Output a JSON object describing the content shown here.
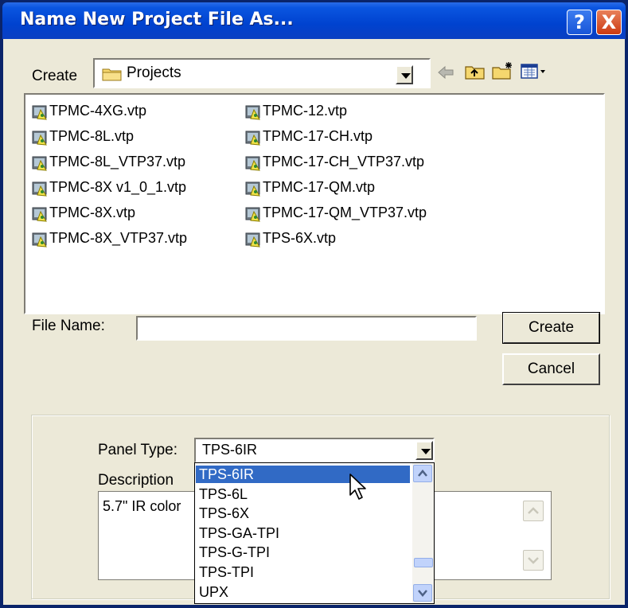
{
  "window": {
    "title": "Name New Project File As...",
    "help_glyph": "?",
    "close_glyph": "X"
  },
  "create_bar": {
    "label": "Create",
    "folder": "Projects",
    "icons": [
      "back-arrow-icon",
      "up-folder-icon",
      "new-folder-icon",
      "view-menu-icon"
    ]
  },
  "files": {
    "column1": [
      "TPMC-4XG.vtp",
      "TPMC-8L.vtp",
      "TPMC-8L_VTP37.vtp",
      "TPMC-8X v1_0_1.vtp",
      "TPMC-8X.vtp",
      "TPMC-8X_VTP37.vtp"
    ],
    "column2": [
      "TPMC-12.vtp",
      "TPMC-17-CH.vtp",
      "TPMC-17-CH_VTP37.vtp",
      "TPMC-17-QM.vtp",
      "TPMC-17-QM_VTP37.vtp",
      "TPS-6X.vtp"
    ]
  },
  "filename": {
    "label": "File Name:",
    "value": ""
  },
  "buttons": {
    "create": "Create",
    "cancel": "Cancel"
  },
  "panel": {
    "type_label": "Panel Type:",
    "type_value": "TPS-6IR",
    "description_label": "Description",
    "description_value": "5.7\" IR color",
    "dropdown_options": [
      "TPS-6IR",
      "TPS-6L",
      "TPS-6X",
      "TPS-GA-TPI",
      "TPS-G-TPI",
      "TPS-TPI",
      "UPX"
    ],
    "selected_index": 0
  },
  "colors": {
    "titlebar": "#0042cf",
    "dialog_bg": "#ece9d8",
    "selection": "#316ac5"
  }
}
